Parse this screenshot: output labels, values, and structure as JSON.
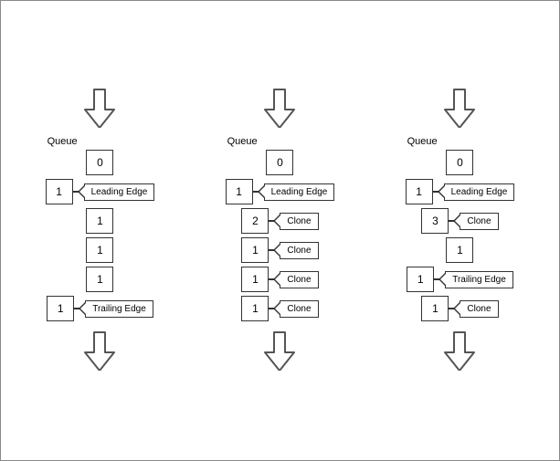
{
  "diagrams": [
    {
      "id": "diagram-1",
      "queue_label": "Queue",
      "cells": [
        {
          "value": "0",
          "tag": null
        },
        {
          "value": "1",
          "tag": "Leading Edge"
        },
        {
          "value": "1",
          "tag": null
        },
        {
          "value": "1",
          "tag": null
        },
        {
          "value": "1",
          "tag": null
        },
        {
          "value": "1",
          "tag": "Trailing Edge"
        }
      ]
    },
    {
      "id": "diagram-2",
      "queue_label": "Queue",
      "cells": [
        {
          "value": "0",
          "tag": null
        },
        {
          "value": "1",
          "tag": "Leading Edge"
        },
        {
          "value": "2",
          "tag": "Clone"
        },
        {
          "value": "1",
          "tag": "Clone"
        },
        {
          "value": "1",
          "tag": "Clone"
        },
        {
          "value": "1",
          "tag": "Clone"
        }
      ]
    },
    {
      "id": "diagram-3",
      "queue_label": "Queue",
      "cells": [
        {
          "value": "0",
          "tag": null
        },
        {
          "value": "1",
          "tag": "Leading Edge"
        },
        {
          "value": "3",
          "tag": "Clone"
        },
        {
          "value": "1",
          "tag": null
        },
        {
          "value": "1",
          "tag": "Trailing Edge"
        },
        {
          "value": "1",
          "tag": "Clone"
        }
      ]
    }
  ]
}
